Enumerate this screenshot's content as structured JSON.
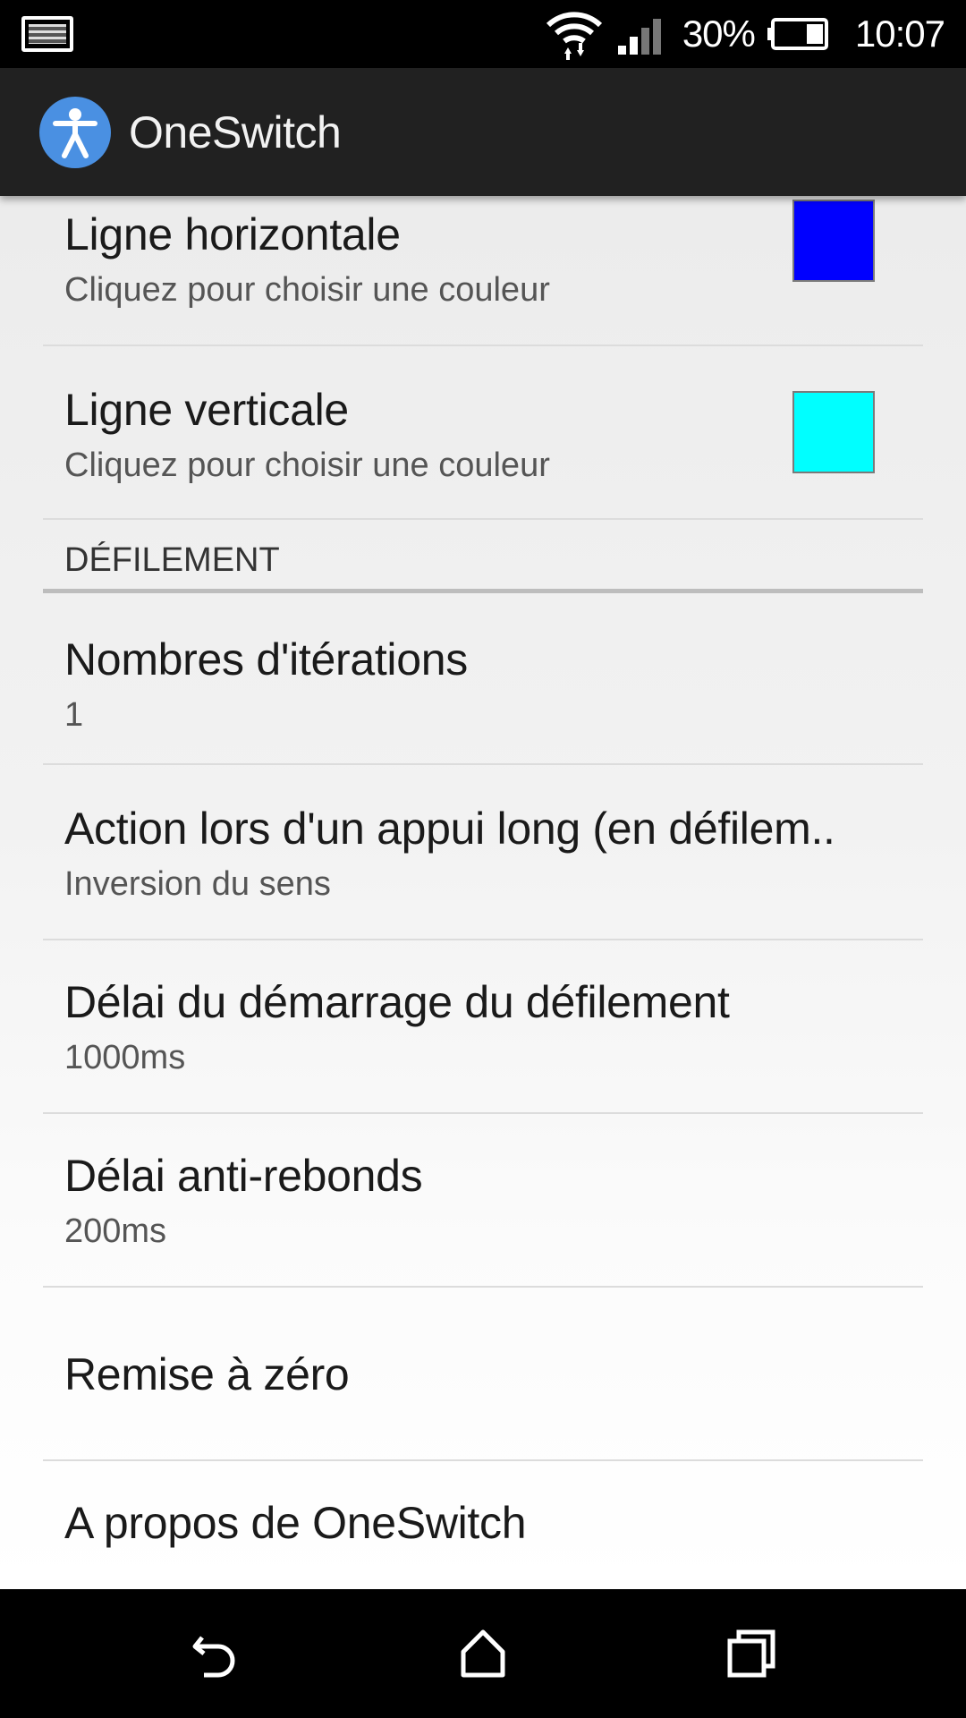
{
  "status_bar": {
    "battery_percent": "30%",
    "time": "10:07",
    "icons": [
      "notification-image-icon",
      "wifi-icon",
      "signal-icon",
      "battery-icon"
    ]
  },
  "app_bar": {
    "title": "OneSwitch",
    "logo_icon": "accessibility-icon",
    "logo_color": "#4a90e2"
  },
  "preferences": {
    "horizontal_line": {
      "title": "Ligne horizontale",
      "summary": "Cliquez pour choisir une couleur",
      "color": "#0000ff"
    },
    "vertical_line": {
      "title": "Ligne verticale",
      "summary": "Cliquez pour choisir une couleur",
      "color": "#00ffff"
    },
    "scroll_category": "DÉFILEMENT",
    "iterations": {
      "title": "Nombres d'itérations",
      "summary": "1"
    },
    "long_press": {
      "title": "Action lors d'un appui long (en défilem..",
      "summary": "Inversion du sens"
    },
    "scroll_delay": {
      "title": "Délai du démarrage du défilement",
      "summary": "1000ms"
    },
    "debounce": {
      "title": "Délai anti-rebonds",
      "summary": "200ms"
    },
    "reset": {
      "title": "Remise à zéro"
    },
    "about": {
      "title": "A propos de OneSwitch"
    }
  },
  "nav_bar": {
    "icons": [
      "back-icon",
      "home-icon",
      "recents-icon"
    ]
  }
}
